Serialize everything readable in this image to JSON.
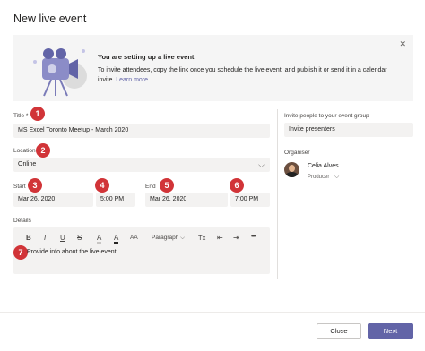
{
  "dialog": {
    "title": "New live event"
  },
  "banner": {
    "heading": "You are setting up a live event",
    "body": "To invite attendees, copy the link once you schedule the live event, and publish it or send it in a calendar invite.",
    "link": "Learn more",
    "close_icon": "close-icon"
  },
  "form": {
    "title_label": "Title",
    "title_required": "*",
    "title_value": "MS Excel Toronto Meetup - March 2020",
    "location_label": "Location",
    "location_value": "Online",
    "start_label": "Start",
    "start_date": "Mar 26, 2020",
    "start_time": "5:00 PM",
    "end_label": "End",
    "end_date": "Mar 26, 2020",
    "end_time": "7:00 PM",
    "details_label": "Details",
    "details_placeholder": "Provide info about the live event"
  },
  "toolbar": {
    "bold": "B",
    "italic": "I",
    "underline": "U",
    "strike": "S",
    "highlight": "A",
    "font_color": "A",
    "font_size": "AA",
    "paragraph": "Paragraph",
    "clear_format": "Tx",
    "more": "•••"
  },
  "side": {
    "invite_label": "Invite people to your event group",
    "invite_value": "Invite presenters",
    "organiser_label": "Organiser",
    "organiser_name": "Celia Alves",
    "organiser_role": "Producer"
  },
  "markers": [
    "1",
    "2",
    "3",
    "4",
    "5",
    "6",
    "7"
  ],
  "footer": {
    "close_label": "Close",
    "next_label": "Next"
  },
  "colors": {
    "accent": "#6264a7",
    "marker": "#d13438",
    "field_bg": "#f3f2f1"
  }
}
